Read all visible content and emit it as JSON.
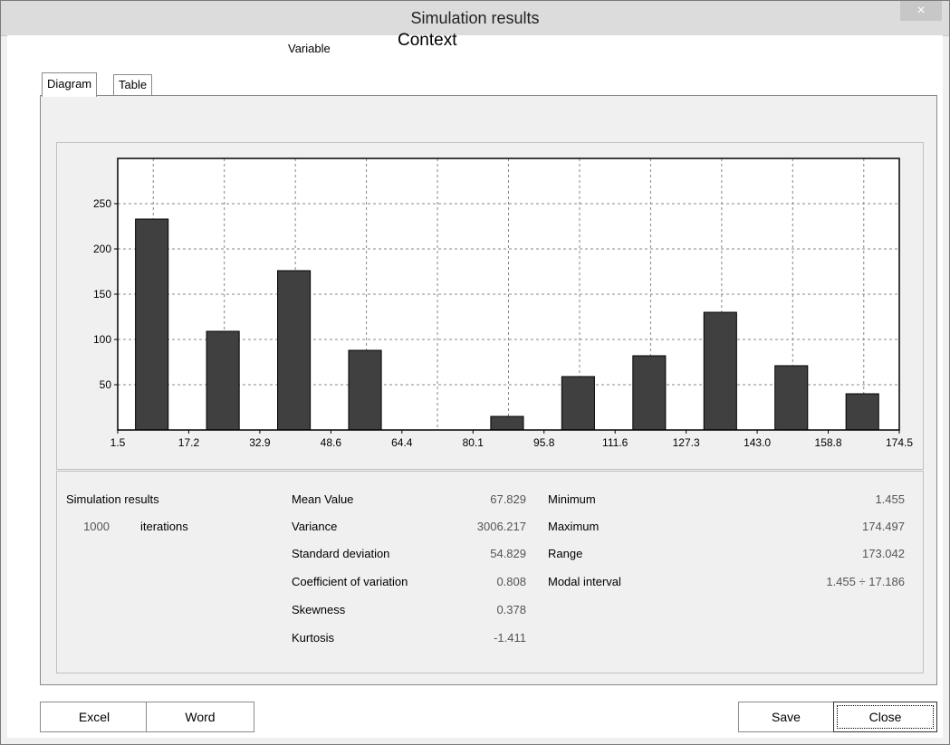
{
  "window": {
    "title": "Simulation results",
    "close_glyph": "×"
  },
  "variable": {
    "label": "Variable",
    "value": "Context"
  },
  "tabs": [
    {
      "label": "Diagram",
      "active": true
    },
    {
      "label": "Table",
      "active": false
    }
  ],
  "chart_data": {
    "type": "bar",
    "title": "",
    "x_ticks": [
      "1.5",
      "17.2",
      "32.9",
      "48.6",
      "64.4",
      "80.1",
      "95.8",
      "111.6",
      "127.3",
      "143.0",
      "158.8",
      "174.5"
    ],
    "categories": [
      "1.5–17.2",
      "17.2–32.9",
      "32.9–48.6",
      "48.6–64.4",
      "64.4–80.1",
      "80.1–95.8",
      "95.8–111.6",
      "111.6–127.3",
      "127.3–143.0",
      "143.0–158.8",
      "158.8–174.5"
    ],
    "values": [
      233,
      109,
      176,
      88,
      0,
      15,
      59,
      82,
      130,
      71,
      40
    ],
    "y_ticks": [
      50,
      100,
      150,
      200,
      250
    ],
    "ylim": [
      0,
      300
    ],
    "grid": true,
    "bar_color": "#404040"
  },
  "stats": {
    "heading": "Simulation results",
    "iterations_value": "1000",
    "iterations_label": "iterations",
    "mean_label": "Mean Value",
    "mean_value": "67.829",
    "variance_label": "Variance",
    "variance_value": "3006.217",
    "std_label": "Standard deviation",
    "std_value": "54.829",
    "cv_label": "Coefficient of variation",
    "cv_value": "0.808",
    "skew_label": "Skewness",
    "skew_value": "0.378",
    "kurt_label": "Kurtosis",
    "kurt_value": "-1.411",
    "min_label": "Minimum",
    "min_value": "1.455",
    "max_label": "Maximum",
    "max_value": "174.497",
    "range_label": "Range",
    "range_value": "173.042",
    "modal_label": "Modal interval",
    "modal_value": "1.455 ÷ 17.186"
  },
  "buttons": {
    "excel": "Excel",
    "word": "Word",
    "save": "Save",
    "close": "Close"
  }
}
